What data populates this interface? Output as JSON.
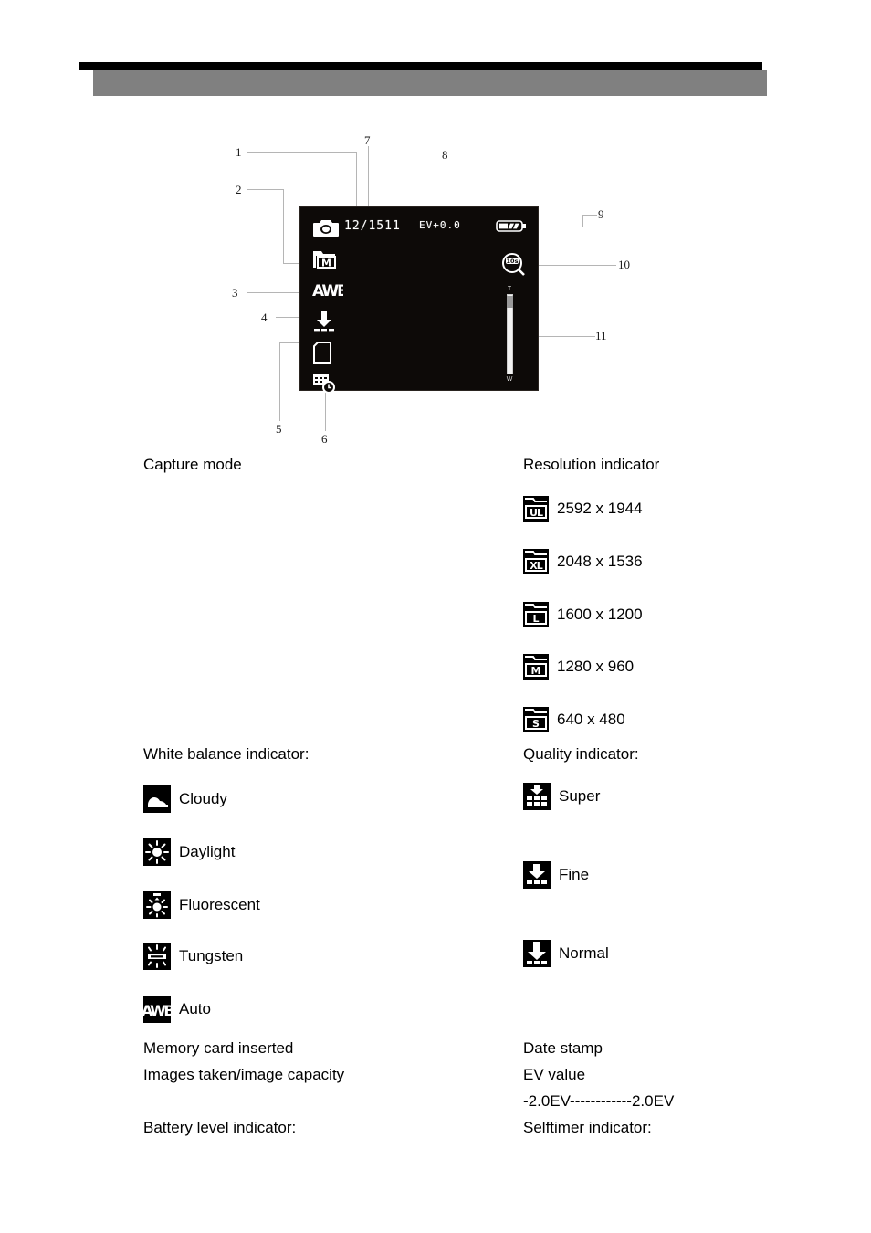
{
  "page": {
    "header": {
      "bar_color": "#000000",
      "band_color": "#808080"
    }
  },
  "figure": {
    "name": "camera-lcd-display-diagram",
    "lcd": {
      "counter": "12/1511",
      "ev": "EV+0.0",
      "zoom_top_label": "T",
      "zoom_bottom_label": "W",
      "icons": [
        "capture-mode-camera-icon",
        "resolution-folder-m-icon",
        "white-balance-awb-icon",
        "quality-normal-icon",
        "memory-card-icon",
        "date-stamp-icon",
        "battery-level-icon",
        "selftimer-icon",
        "zoom-slider"
      ]
    },
    "callouts": [
      {
        "number": "1"
      },
      {
        "number": "2"
      },
      {
        "number": "3"
      },
      {
        "number": "4"
      },
      {
        "number": "5"
      },
      {
        "number": "6"
      },
      {
        "number": "7"
      },
      {
        "number": "8"
      },
      {
        "number": "9"
      },
      {
        "number": "10"
      },
      {
        "number": "11"
      }
    ]
  },
  "left_column": {
    "capture_mode": "Capture mode",
    "white_balance_heading": "White balance indicator:",
    "white_balance_items": [
      {
        "icon": "cloudy-icon",
        "label": "Cloudy"
      },
      {
        "icon": "daylight-icon",
        "label": "Daylight"
      },
      {
        "icon": "fluorescent-icon",
        "label": "Fluorescent"
      },
      {
        "icon": "tungsten-icon",
        "label": "Tungsten"
      },
      {
        "icon": "awb-icon",
        "label": "Auto"
      }
    ],
    "memory_card": "Memory card inserted",
    "images_capacity": "Images taken/image capacity",
    "battery_heading": "Battery level indicator:"
  },
  "right_column": {
    "resolution_heading": "Resolution indicator",
    "resolution_items": [
      {
        "icon": "folder-ul-icon",
        "badge": "UL",
        "label": "2592 x 1944"
      },
      {
        "icon": "folder-xl-icon",
        "badge": "XL",
        "label": "2048 x 1536"
      },
      {
        "icon": "folder-l-icon",
        "badge": "L",
        "label": "1600 x 1200"
      },
      {
        "icon": "folder-m-icon",
        "badge": "M",
        "label": "1280 x 960"
      },
      {
        "icon": "folder-s-icon",
        "badge": "S",
        "label": "640 x 480"
      }
    ],
    "quality_heading": "Quality indicator:",
    "quality_items": [
      {
        "icon": "quality-super-icon",
        "label": "Super"
      },
      {
        "icon": "quality-fine-icon",
        "label": "Fine"
      },
      {
        "icon": "quality-normal-icon",
        "label": "Normal"
      }
    ],
    "date_stamp": "Date stamp",
    "ev_value": "EV value",
    "ev_range": "-2.0EV------------2.0EV",
    "selftimer_heading": "Selftimer indicator:"
  }
}
